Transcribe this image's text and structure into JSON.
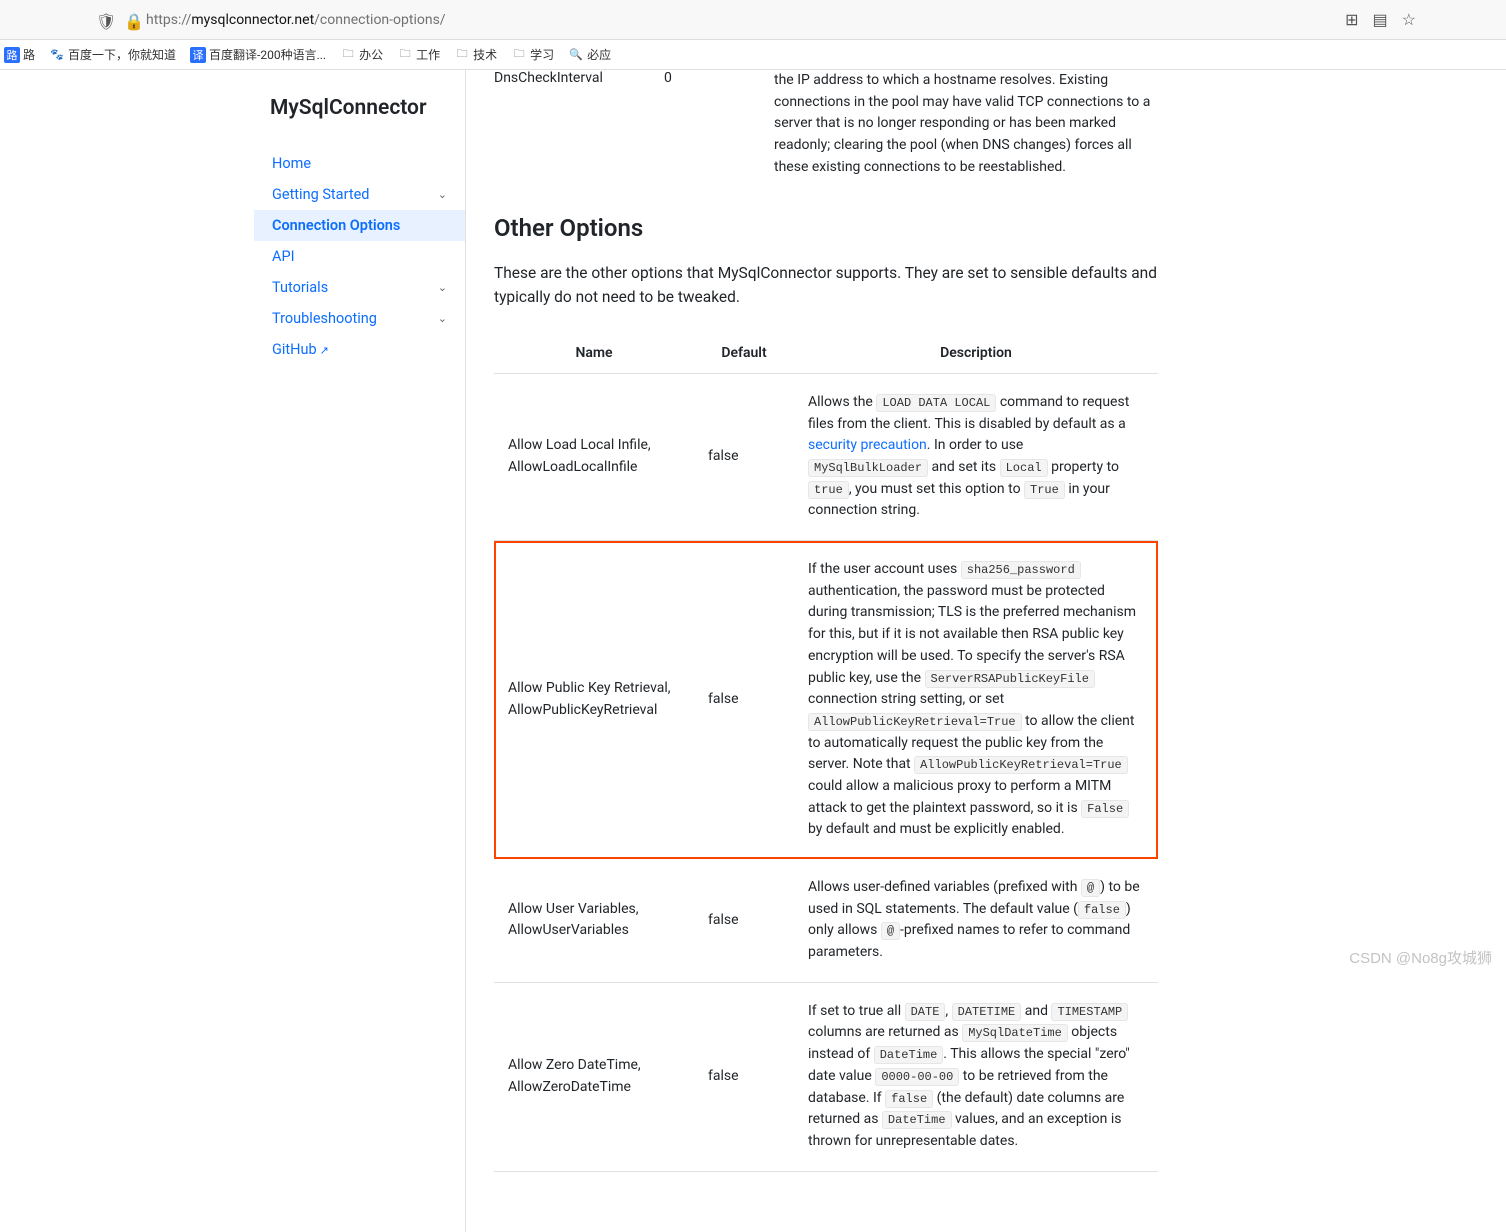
{
  "browser": {
    "url_prefix": "https://",
    "url_domain": "mysqlconnector.net",
    "url_path": "/connection-options/"
  },
  "bookmarks": [
    {
      "label": "路"
    },
    {
      "label": "百度一下，你就知道"
    },
    {
      "label": "百度翻译-200种语言..."
    },
    {
      "label": "办公"
    },
    {
      "label": "工作"
    },
    {
      "label": "技术"
    },
    {
      "label": "学习"
    },
    {
      "label": "必应"
    }
  ],
  "sidebar": {
    "title": "MySqlConnector",
    "items": [
      {
        "label": "Home",
        "expandable": false
      },
      {
        "label": "Getting Started",
        "expandable": true
      },
      {
        "label": "Connection Options",
        "expandable": false,
        "active": true
      },
      {
        "label": "API",
        "expandable": false
      },
      {
        "label": "Tutorials",
        "expandable": true
      },
      {
        "label": "Troubleshooting",
        "expandable": true
      },
      {
        "label": "GitHub",
        "expandable": false,
        "external": true
      }
    ]
  },
  "dns_row": {
    "name": "DnsCheckInterval",
    "default": "0",
    "desc": "the IP address to which a hostname resolves. Existing connections in the pool may have valid TCP connections to a server that is no longer responding or has been marked readonly; clearing the pool (when DNS changes) forces all these existing connections to be reestablished."
  },
  "section": {
    "heading": "Other Options",
    "intro": "These are the other options that MySqlConnector supports. They are set to sensible defaults and typically do not need to be tweaked."
  },
  "table": {
    "headers": {
      "name": "Name",
      "default": "Default",
      "desc": "Description"
    },
    "rows": [
      {
        "name": "Allow Load Local Infile, AllowLoadLocalInfile",
        "default": "false",
        "desc": {
          "t1": "Allows the ",
          "c1": "LOAD DATA LOCAL",
          "t2": " command to request files from the client. This is disabled by default as a ",
          "link": "security precaution",
          "t3": ". In order to use ",
          "c2": "MySqlBulkLoader",
          "t4": " and set its ",
          "c3": "Local",
          "t5": " property to ",
          "c4": "true",
          "t6": ", you must set this option to ",
          "c5": "True",
          "t7": " in your connection string."
        }
      },
      {
        "name": "Allow Public Key Retrieval, AllowPublicKeyRetrieval",
        "default": "false",
        "highlighted": true,
        "desc": {
          "t1": "If the user account uses ",
          "c1": "sha256_password",
          "t2": " authentication, the password must be protected during transmission; TLS is the preferred mechanism for this, but if it is not available then RSA public key encryption will be used. To specify the server's RSA public key, use the ",
          "c2": "ServerRSAPublicKeyFile",
          "t3": " connection string setting, or set ",
          "c3": "AllowPublicKeyRetrieval=True",
          "t4": " to allow the client to automatically request the public key from the server. Note that ",
          "c4": "AllowPublicKeyRetrieval=True",
          "t5": " could allow a malicious proxy to perform a MITM attack to get the plaintext password, so it is ",
          "c5": "False",
          "t6": " by default and must be explicitly enabled."
        }
      },
      {
        "name": "Allow User Variables, AllowUserVariables",
        "default": "false",
        "desc": {
          "t1": "Allows user-defined variables (prefixed with ",
          "c1": "@",
          "t2": ") to be used in SQL statements. The default value (",
          "c2": "false",
          "t3": ") only allows ",
          "c3": "@",
          "t4": "-prefixed names to refer to command parameters."
        }
      },
      {
        "name": "Allow Zero DateTime, AllowZeroDateTime",
        "default": "false",
        "desc": {
          "t1": "If set to true all ",
          "c1": "DATE",
          "t1b": ", ",
          "c1b": "DATETIME",
          "t2": " and ",
          "c2": "TIMESTAMP",
          "t3": " columns are returned as ",
          "c3": "MySqlDateTime",
          "t4": " objects instead of ",
          "c4": "DateTime",
          "t5": ". This allows the special \"zero\" date value ",
          "c5": "0000-00-00",
          "t6": " to be retrieved from the database. If ",
          "c6": "false",
          "t7": " (the default) date columns are returned as ",
          "c7": "DateTime",
          "t8": " values, and an exception is thrown for unrepresentable dates."
        }
      }
    ]
  },
  "watermark": "CSDN @No8g攻城狮"
}
